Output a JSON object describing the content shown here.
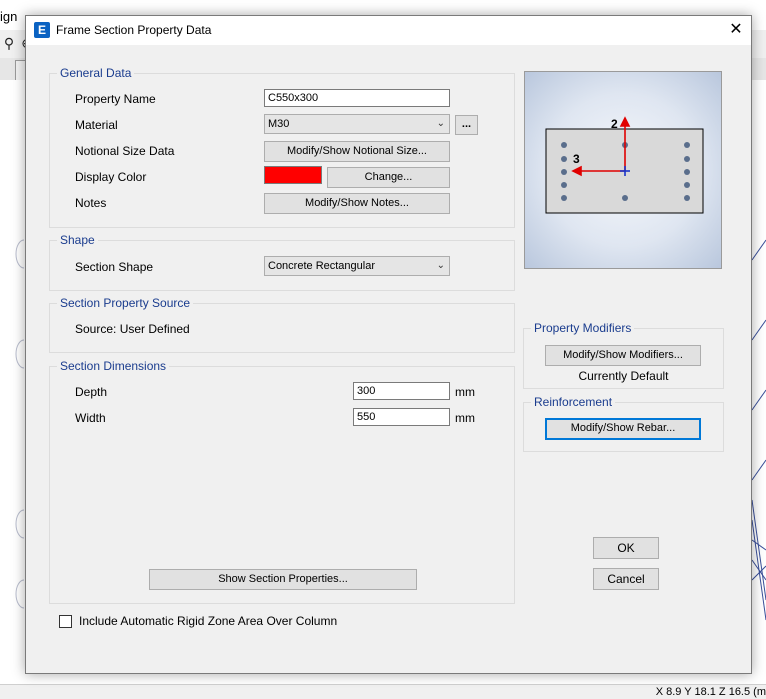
{
  "background": {
    "menu_text": "ign",
    "status_text": "X 8.9  Y 18.1  Z 16.5 (m",
    "toolbar_icons": [
      "zoom-in-icon",
      "zoom-out-icon"
    ]
  },
  "dialog": {
    "title": "Frame Section Property Data",
    "close_glyph": "✕",
    "app_icon_letter": "E"
  },
  "general_data": {
    "title": "General Data",
    "property_name_label": "Property Name",
    "property_name_value": "C550x300",
    "material_label": "Material",
    "material_value": "M30",
    "material_browse_label": "...",
    "notional_label": "Notional Size Data",
    "notional_button": "Modify/Show Notional Size...",
    "display_color_label": "Display Color",
    "display_color": "#ff0000",
    "change_button": "Change...",
    "notes_label": "Notes",
    "notes_button": "Modify/Show Notes..."
  },
  "shape": {
    "title": "Shape",
    "section_shape_label": "Section Shape",
    "section_shape_value": "Concrete Rectangular"
  },
  "source": {
    "title": "Section Property Source",
    "source_text": "Source:  User Defined"
  },
  "dimensions": {
    "title": "Section Dimensions",
    "depth_label": "Depth",
    "depth_value": "300",
    "depth_unit": "mm",
    "width_label": "Width",
    "width_value": "550",
    "width_unit": "mm",
    "show_properties_button": "Show Section Properties..."
  },
  "preview": {
    "axis_2_label": "2",
    "axis_3_label": "3"
  },
  "modifiers": {
    "title": "Property Modifiers",
    "button": "Modify/Show Modifiers...",
    "status": "Currently Default"
  },
  "reinforcement": {
    "title": "Reinforcement",
    "button": "Modify/Show Rebar..."
  },
  "actions": {
    "ok": "OK",
    "cancel": "Cancel"
  },
  "rigid_zone": {
    "label": "Include Automatic Rigid Zone Area Over Column",
    "checked": false
  },
  "colors": {
    "group_title": "#1a3c8e",
    "axis_red": "#e00000",
    "axis_blue": "#1a34c8",
    "rebar": "#5a6e8c"
  }
}
